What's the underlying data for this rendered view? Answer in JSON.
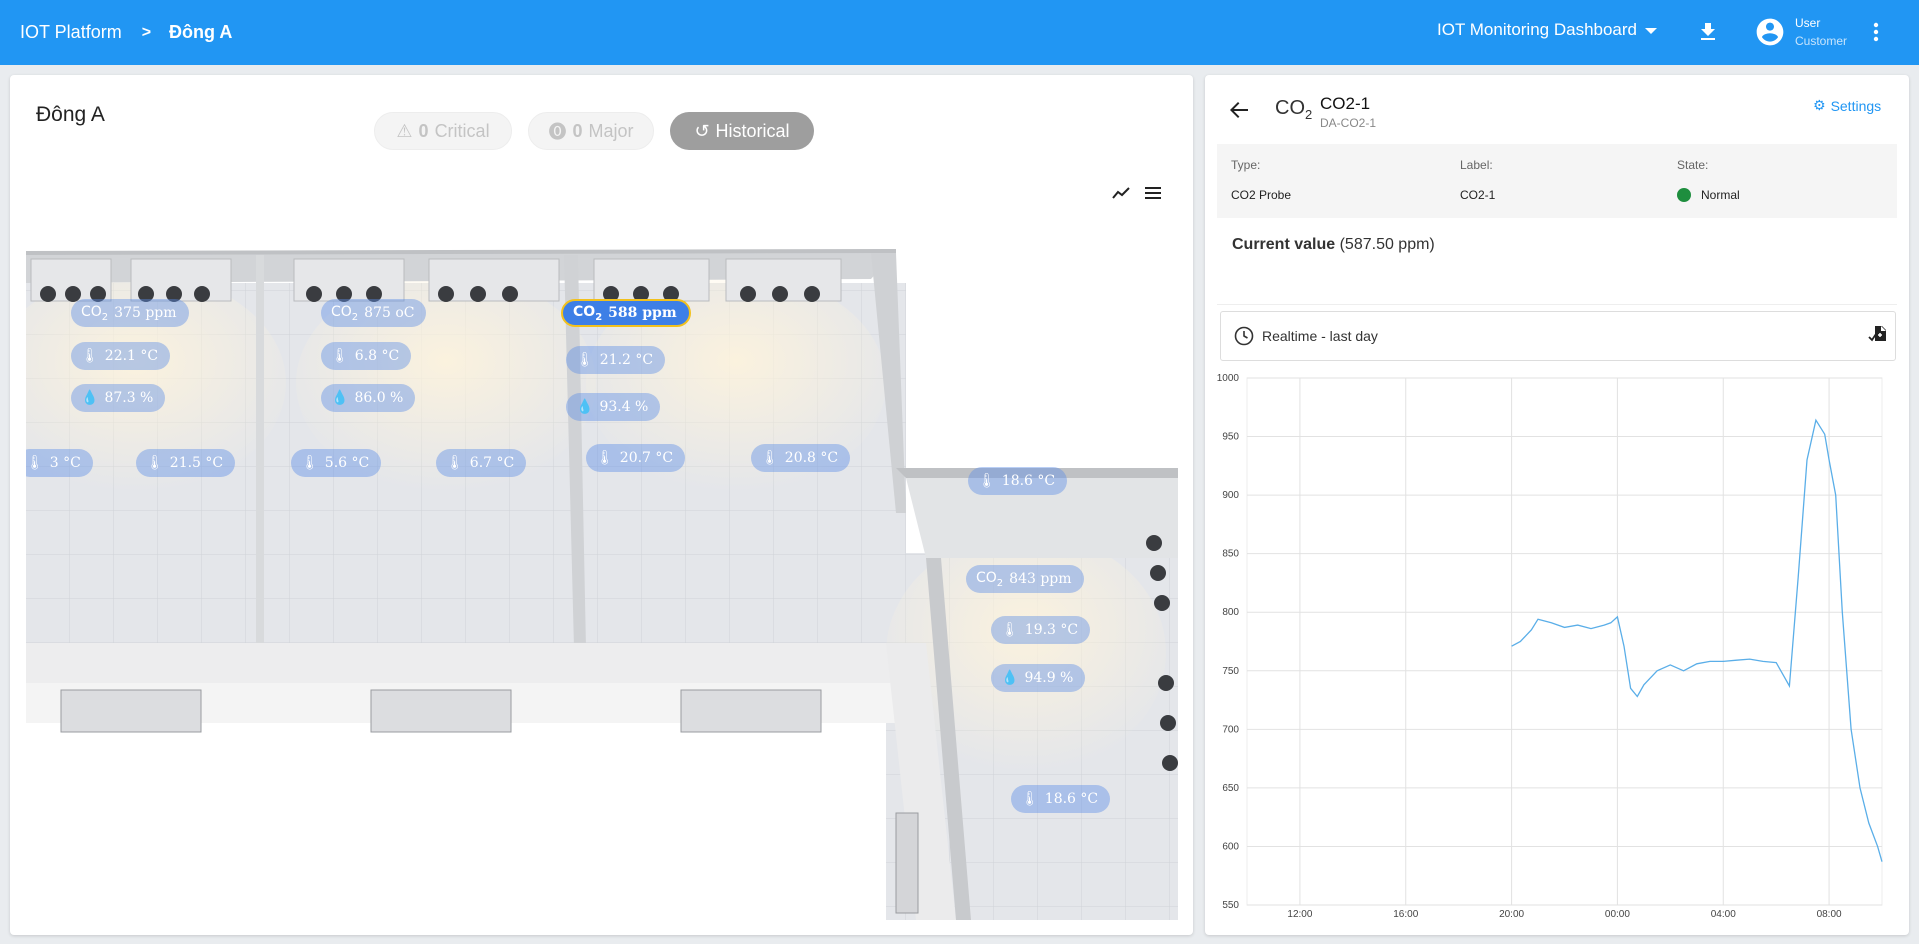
{
  "topbar": {
    "platform": "IOT Platform",
    "separator": ">",
    "current": "Đông A",
    "dashboard": "IOT Monitoring Dashboard",
    "user_name": "User",
    "user_role": "Customer"
  },
  "left": {
    "title": "Đông A",
    "critical_count": "0",
    "critical_label": "Critical",
    "major_count": "0",
    "major_label": "Major",
    "historical_label": "Historical"
  },
  "badges": [
    {
      "kind": "co2",
      "text": "375 ppm"
    },
    {
      "kind": "co2",
      "text": "875 oC"
    },
    {
      "kind": "co2",
      "text": "588 ppm",
      "active": true
    },
    {
      "kind": "temp",
      "text": "22.1 °C"
    },
    {
      "kind": "temp",
      "text": "6.8 °C"
    },
    {
      "kind": "temp",
      "text": "21.2 °C"
    },
    {
      "kind": "hum",
      "text": "87.3 %"
    },
    {
      "kind": "hum",
      "text": "86.0 %"
    },
    {
      "kind": "hum",
      "text": "93.4 %"
    },
    {
      "kind": "temp",
      "text": "3 °C"
    },
    {
      "kind": "temp",
      "text": "21.5 °C"
    },
    {
      "kind": "temp",
      "text": "5.6 °C"
    },
    {
      "kind": "temp",
      "text": "6.7 °C"
    },
    {
      "kind": "temp",
      "text": "20.7 °C"
    },
    {
      "kind": "temp",
      "text": "20.8 °C"
    },
    {
      "kind": "temp",
      "text": "18.6 °C"
    },
    {
      "kind": "co2",
      "text": "843 ppm"
    },
    {
      "kind": "temp",
      "text": "19.3 °C"
    },
    {
      "kind": "hum",
      "text": "94.9 %"
    },
    {
      "kind": "temp",
      "text": "18.6 °C"
    }
  ],
  "right": {
    "device_symbol": "CO",
    "device_symbol_sub": "2",
    "device_name": "CO2-1",
    "device_id": "DA-CO2-1",
    "settings_label": "Settings",
    "type_label": "Type:",
    "type_value": "CO2 Probe",
    "label_label": "Label:",
    "label_value": "CO2-1",
    "state_label": "State:",
    "state_value": "Normal",
    "current_value_label": "Current value",
    "current_value": "(587.50 ppm)",
    "time_window": "Realtime - last day"
  },
  "colors": {
    "primary": "#2196f3",
    "line": "#5aaee8",
    "normal": "#1e8e3e"
  },
  "chart_data": {
    "type": "line",
    "ylim": [
      550,
      1000
    ],
    "yticks": [
      550,
      600,
      650,
      700,
      750,
      800,
      850,
      900,
      950,
      1000
    ],
    "xticks": [
      "12:00",
      "16:00",
      "20:00",
      "00:00",
      "04:00",
      "08:00"
    ],
    "xlim": [
      "10:00",
      "10:00"
    ],
    "series": [
      {
        "x": [
          "20:00",
          "20:20",
          "20:45",
          "21:00",
          "21:30",
          "22:00",
          "22:30",
          "23:00",
          "23:30",
          "23:45",
          "00:00",
          "00:15",
          "00:30",
          "00:45",
          "01:00",
          "01:30",
          "02:00",
          "02:30",
          "03:00",
          "03:30",
          "04:00",
          "04:30",
          "05:00",
          "05:30",
          "06:00",
          "06:30",
          "06:50",
          "07:10",
          "07:30",
          "07:50",
          "08:00",
          "08:15",
          "08:30",
          "08:50",
          "09:10",
          "09:30",
          "09:50",
          "10:00"
        ],
        "y": [
          771,
          775,
          785,
          794,
          791,
          787,
          789,
          786,
          789,
          791,
          796,
          771,
          735,
          728,
          738,
          750,
          755,
          750,
          756,
          758,
          758,
          759,
          760,
          758,
          757,
          737,
          830,
          930,
          964,
          952,
          930,
          900,
          800,
          700,
          650,
          620,
          600,
          587
        ]
      }
    ]
  }
}
